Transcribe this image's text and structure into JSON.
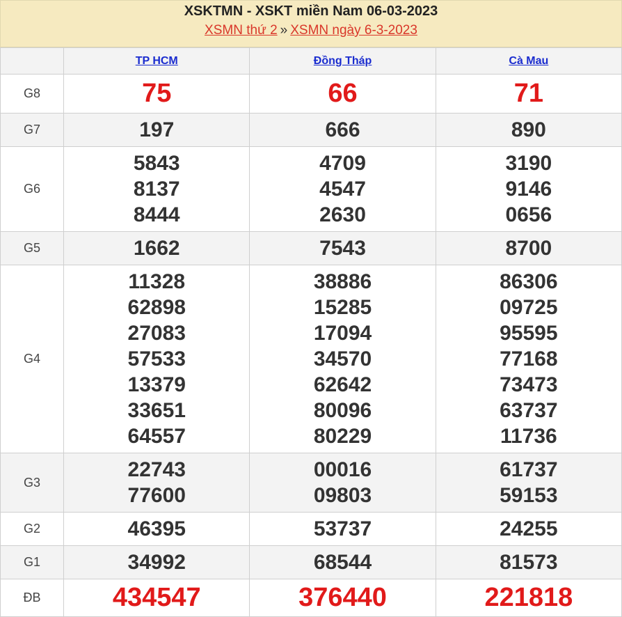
{
  "header": {
    "title": "XSKTMN - XSKT miền Nam 06-03-2023",
    "crumb1": "XSMN thứ 2",
    "separator": "»",
    "crumb2": "XSMN ngày 6-3-2023"
  },
  "columns": [
    "TP HCM",
    "Đồng Tháp",
    "Cà Mau"
  ],
  "colors": {
    "header_bg": "#f6eac0",
    "link_red": "#d9372a",
    "link_blue": "#1a2ccf",
    "prize_red": "#e11a1a"
  },
  "prizes": [
    {
      "label": "G8",
      "values": [
        [
          "75"
        ],
        [
          "66"
        ],
        [
          "71"
        ]
      ]
    },
    {
      "label": "G7",
      "values": [
        [
          "197"
        ],
        [
          "666"
        ],
        [
          "890"
        ]
      ]
    },
    {
      "label": "G6",
      "values": [
        [
          "5843",
          "8137",
          "8444"
        ],
        [
          "4709",
          "4547",
          "2630"
        ],
        [
          "3190",
          "9146",
          "0656"
        ]
      ]
    },
    {
      "label": "G5",
      "values": [
        [
          "1662"
        ],
        [
          "7543"
        ],
        [
          "8700"
        ]
      ]
    },
    {
      "label": "G4",
      "values": [
        [
          "11328",
          "62898",
          "27083",
          "57533",
          "13379",
          "33651",
          "64557"
        ],
        [
          "38886",
          "15285",
          "17094",
          "34570",
          "62642",
          "80096",
          "80229"
        ],
        [
          "86306",
          "09725",
          "95595",
          "77168",
          "73473",
          "63737",
          "11736"
        ]
      ]
    },
    {
      "label": "G3",
      "values": [
        [
          "22743",
          "77600"
        ],
        [
          "00016",
          "09803"
        ],
        [
          "61737",
          "59153"
        ]
      ]
    },
    {
      "label": "G2",
      "values": [
        [
          "46395"
        ],
        [
          "53737"
        ],
        [
          "24255"
        ]
      ]
    },
    {
      "label": "G1",
      "values": [
        [
          "34992"
        ],
        [
          "68544"
        ],
        [
          "81573"
        ]
      ]
    },
    {
      "label": "ĐB",
      "values": [
        [
          "434547"
        ],
        [
          "376440"
        ],
        [
          "221818"
        ]
      ]
    }
  ]
}
